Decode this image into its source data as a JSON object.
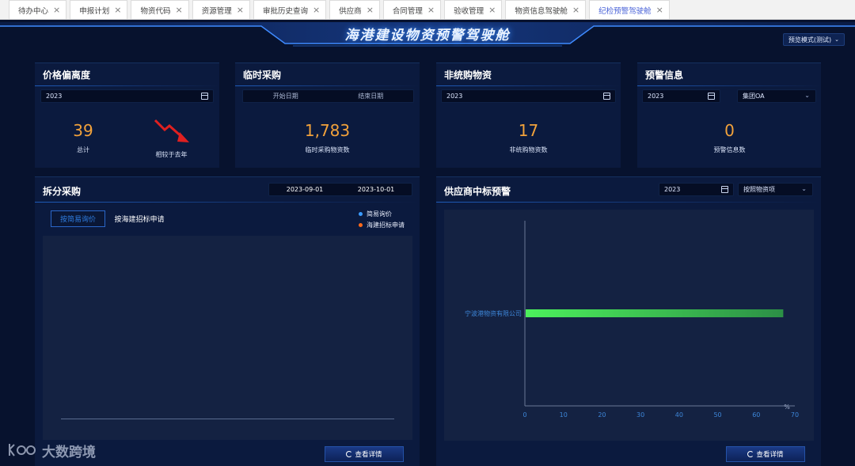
{
  "tabs": [
    {
      "label": "待办中心",
      "active": false
    },
    {
      "label": "申报计划",
      "active": false
    },
    {
      "label": "物资代码",
      "active": false
    },
    {
      "label": "资源管理",
      "active": false
    },
    {
      "label": "审批历史查询",
      "active": false
    },
    {
      "label": "供应商",
      "active": false
    },
    {
      "label": "合同管理",
      "active": false
    },
    {
      "label": "验收管理",
      "active": false
    },
    {
      "label": "物资信息驾驶舱",
      "active": false
    },
    {
      "label": "纪检预警驾驶舱",
      "active": true
    }
  ],
  "tab_close_glyph": "×",
  "header": {
    "title": "海港建设物资预警驾驶舱",
    "mode_button": "预览模式(测试)",
    "mode_chevron": "⌄"
  },
  "price_deviation": {
    "title": "价格偏离度",
    "year": "2023",
    "total_value": "39",
    "total_label": "总计",
    "compare_label": "相较于去年",
    "trend": "down",
    "trend_color": "#e02020"
  },
  "temp_purchase": {
    "title": "临时采购",
    "start_placeholder": "开始日期",
    "end_placeholder": "结束日期",
    "count_value": "1,783",
    "count_label": "临时采购物资数"
  },
  "non_system": {
    "title": "非统购物资",
    "year": "2023",
    "count_value": "17",
    "count_label": "非统购物资数"
  },
  "warning_info": {
    "title": "预警信息",
    "year": "2023",
    "source_select": "集团OA",
    "count_value": "0",
    "count_label": "预警信息数"
  },
  "split_purchase": {
    "title": "拆分采购",
    "date_start": "2023-09-01",
    "date_end": "2023-10-01",
    "sub_tabs": [
      "按简易询价",
      "按海建招标申请"
    ],
    "active_sub_tab": 0,
    "legend": [
      {
        "label": "简易询价",
        "color": "#3a9bff"
      },
      {
        "label": "海建招标申请",
        "color": "#ff6a1a"
      }
    ],
    "detail_button": "查看详情"
  },
  "supplier_bid": {
    "title": "供应商中标预警",
    "year": "2023",
    "group_select": "按照物资项",
    "detail_button": "查看详情"
  },
  "chart_data": {
    "type": "bar",
    "orientation": "horizontal",
    "categories": [
      "宁波港物资有限公司"
    ],
    "values": [
      67
    ],
    "xlim": [
      0,
      70
    ],
    "xticks": [
      0,
      10,
      20,
      30,
      40,
      50,
      60,
      70
    ],
    "xunit": "%",
    "bar_color_start": "#4cf05c",
    "bar_color_end": "#2c8f46"
  },
  "watermark": {
    "text": "大数跨境"
  }
}
